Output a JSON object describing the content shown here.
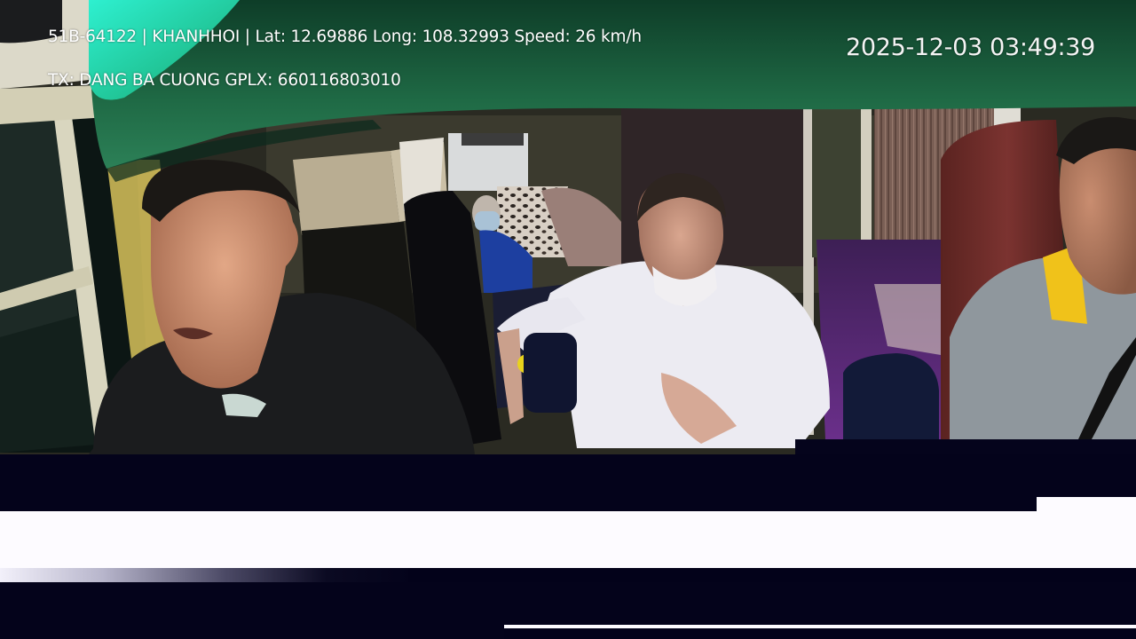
{
  "overlay": {
    "info_line": "51B-64122 | KHANHHOI | Lat: 12.69886 Long: 108.32993 Speed: 26 km/h",
    "driver_line": "TX: DANG BA CUONG GPLX: 660116803010",
    "timestamp": "2025-12-03 03:49:39"
  },
  "colors": {
    "overlay_text": "#ffffff",
    "letterbox_dark": "#04031b",
    "letterbox_light": "#fdfbff",
    "green_panel": "#1f6a45",
    "purple_floor": "#5a2a78"
  }
}
